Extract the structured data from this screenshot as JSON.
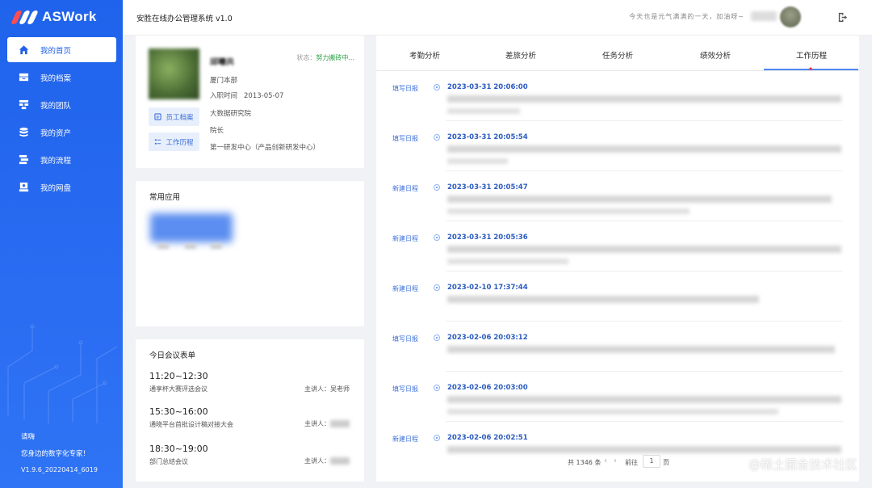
{
  "sidebar": {
    "logo_text": "ASWork",
    "logo_colors": [
      "#ff4d4f",
      "#ffffff",
      "#ffffff"
    ],
    "items": [
      {
        "label": "我的首页",
        "icon": "home-icon",
        "active": true
      },
      {
        "label": "我的档案",
        "icon": "archive-icon",
        "active": false
      },
      {
        "label": "我的团队",
        "icon": "team-icon",
        "active": false
      },
      {
        "label": "我的资产",
        "icon": "asset-icon",
        "active": false
      },
      {
        "label": "我的流程",
        "icon": "workflow-icon",
        "active": false
      },
      {
        "label": "我的网盘",
        "icon": "cloud-drive-icon",
        "active": false
      }
    ],
    "greeting": "请嗨",
    "tagline": "您身边的数字化专家！",
    "version": "V1.9.6_20220414_6019"
  },
  "header": {
    "title": "安胜在线办公管理系统 v1.0",
    "slogan": "今天也是元气满满的一天，加油呀~"
  },
  "profile": {
    "name": "邱曦共",
    "status_label": "状态：",
    "status_value": "努力搬砖中...",
    "location": "厦门本部",
    "join_label": "入职时间",
    "join_date": "2013-05-07",
    "department": "大数据研究院",
    "position": "院长",
    "center": "第一研发中心（产品创新研发中心）",
    "btn_archive": "员工档案",
    "btn_history": "工作历程"
  },
  "apps": {
    "title": "常用应用"
  },
  "meetings": {
    "title": "今日会议表单",
    "speaker_label": "主讲人：",
    "items": [
      {
        "time": "11:20~12:30",
        "name": "通享杯大赛评选会议",
        "speaker": "吴老师"
      },
      {
        "time": "15:30~16:00",
        "name": "通晓平台首批设计稿对接大会",
        "speaker": ""
      },
      {
        "time": "18:30~19:00",
        "name": "部门总结会议",
        "speaker": ""
      }
    ]
  },
  "tabs": [
    {
      "label": "考勤分析",
      "active": false
    },
    {
      "label": "差旅分析",
      "active": false
    },
    {
      "label": "任务分析",
      "active": false
    },
    {
      "label": "绩效分析",
      "active": false
    },
    {
      "label": "工作历程",
      "active": true
    }
  ],
  "timeline": [
    {
      "type": "填写日报",
      "time": "2023-03-31 20:06:00"
    },
    {
      "type": "填写日报",
      "time": "2023-03-31 20:05:54"
    },
    {
      "type": "新建日程",
      "time": "2023-03-31 20:05:47"
    },
    {
      "type": "新建日程",
      "time": "2023-03-31 20:05:36"
    },
    {
      "type": "新建日程",
      "time": "2023-02-10 17:37:44"
    },
    {
      "type": "填写日报",
      "time": "2023-02-06 20:03:12"
    },
    {
      "type": "填写日报",
      "time": "2023-02-06 20:03:00"
    },
    {
      "type": "新建日程",
      "time": "2023-02-06 20:02:51"
    }
  ],
  "pagination": {
    "total": "共 1346 条",
    "prev": "‹",
    "next": "›",
    "goto": "前往",
    "page": "1",
    "unit": "页"
  },
  "watermark": "@稀土掘金技术社区",
  "colors": {
    "primary": "#2160e8",
    "link": "#3b6fd8",
    "status_green": "#2ba245"
  }
}
